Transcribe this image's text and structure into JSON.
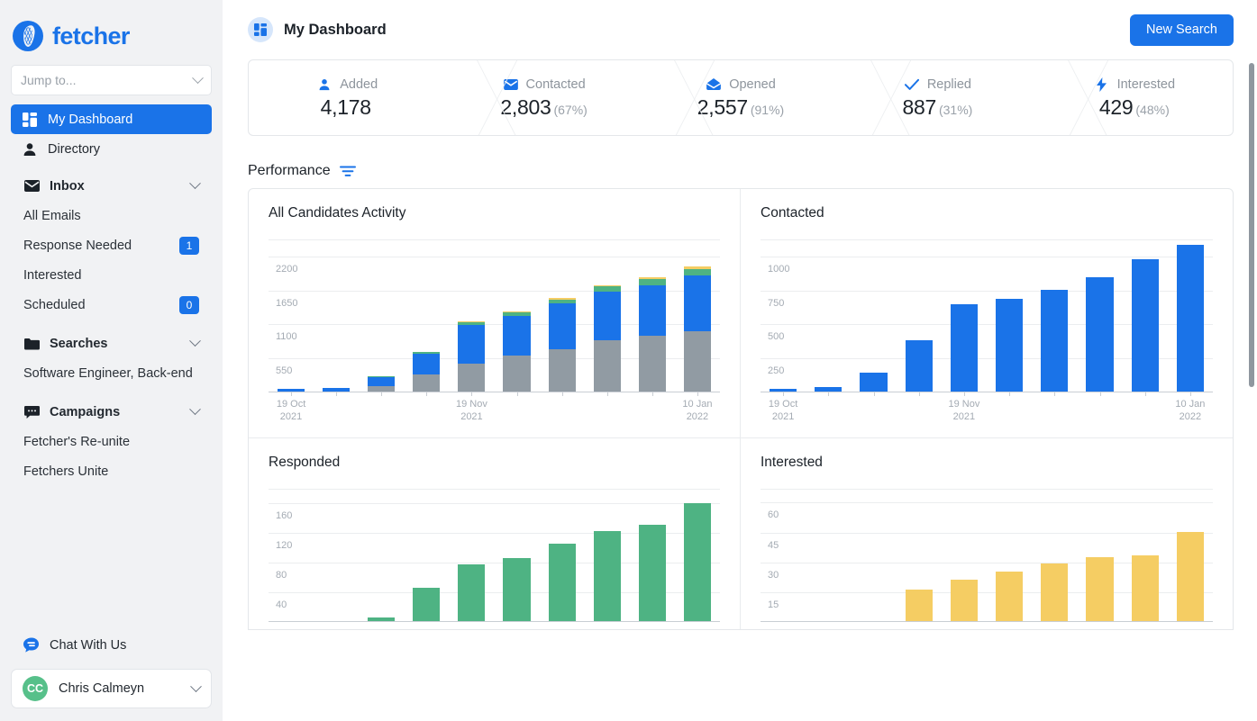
{
  "brand": {
    "name": "fetcher",
    "logo_icon": "fetcher-logo-icon",
    "accent": "#1a73e8"
  },
  "sidebar": {
    "jump_to": {
      "placeholder": "Jump to...",
      "value": "",
      "chevron_icon": "chevron-down-icon"
    },
    "nav": [
      {
        "id": "my-dashboard",
        "label": "My Dashboard",
        "icon": "dashboard-grid-icon",
        "active": true
      },
      {
        "id": "directory",
        "label": "Directory",
        "icon": "person-icon",
        "active": false
      }
    ],
    "groups": [
      {
        "id": "inbox",
        "label": "Inbox",
        "icon": "envelope-icon",
        "chevron_icon": "chevron-down-icon",
        "items": [
          {
            "label": "All Emails",
            "badge": null
          },
          {
            "label": "Response Needed",
            "badge": "1"
          },
          {
            "label": "Interested",
            "badge": null
          },
          {
            "label": "Scheduled",
            "badge": "0"
          }
        ]
      },
      {
        "id": "searches",
        "label": "Searches",
        "icon": "folder-icon",
        "chevron_icon": "chevron-down-icon",
        "items": [
          {
            "label": "Software Engineer, Back-end",
            "badge": null
          }
        ]
      },
      {
        "id": "campaigns",
        "label": "Campaigns",
        "icon": "chat-bubble-icon",
        "chevron_icon": "chevron-down-icon",
        "items": [
          {
            "label": "Fetcher's Re-unite",
            "badge": null
          },
          {
            "label": "Fetchers Unite",
            "badge": null
          }
        ]
      }
    ],
    "chat": {
      "label": "Chat With Us",
      "icon": "chat-support-icon"
    },
    "user": {
      "initials": "CC",
      "name": "Chris Calmeyn",
      "avatar_color": "#57c08a",
      "chevron_icon": "chevron-down-icon"
    }
  },
  "header": {
    "title": "My Dashboard",
    "title_icon": "dashboard-grid-icon",
    "new_search_label": "New Search"
  },
  "stats": [
    {
      "id": "added",
      "label": "Added",
      "icon": "person-icon",
      "value": "4,178",
      "percent": ""
    },
    {
      "id": "contacted",
      "label": "Contacted",
      "icon": "envelope-icon",
      "value": "2,803",
      "percent": "(67%)"
    },
    {
      "id": "opened",
      "label": "Opened",
      "icon": "open-mail-icon",
      "value": "2,557",
      "percent": "(91%)"
    },
    {
      "id": "replied",
      "label": "Replied",
      "icon": "check-icon",
      "value": "887",
      "percent": "(31%)"
    },
    {
      "id": "interested",
      "label": "Interested",
      "icon": "bolt-icon",
      "value": "429",
      "percent": "(48%)"
    }
  ],
  "performance": {
    "title": "Performance",
    "filter_icon": "filter-icon"
  },
  "chart_data": [
    {
      "id": "all-candidates-activity",
      "type": "bar",
      "stacked": true,
      "title": "All Candidates Activity",
      "xlabel": "",
      "ylabel": "",
      "ylim": [
        0,
        2475
      ],
      "yticks": [
        550,
        1100,
        1650,
        2200
      ],
      "ytick_labels": [
        "550",
        "1100",
        "1650",
        "2200"
      ],
      "grid": true,
      "x": [
        "19 Oct\n2021",
        "",
        "",
        "",
        "19 Nov\n2021",
        "",
        "",
        "",
        "",
        "10 Jan\n2022"
      ],
      "tick_labels": [
        {
          "index": 0,
          "text_line1": "19 Oct",
          "text_line2": "2021"
        },
        {
          "index": 4,
          "text_line1": "19 Nov",
          "text_line2": "2021"
        },
        {
          "index": 9,
          "text_line1": "10 Jan",
          "text_line2": "2022"
        }
      ],
      "series": [
        {
          "name": "Added",
          "color": "#919ba3",
          "values": [
            0,
            0,
            90,
            280,
            450,
            580,
            690,
            830,
            900,
            980
          ]
        },
        {
          "name": "Contacted",
          "color": "#1a73e8",
          "values": [
            40,
            55,
            145,
            330,
            630,
            640,
            730,
            790,
            820,
            900
          ]
        },
        {
          "name": "Responded",
          "color": "#4eb383",
          "values": [
            0,
            0,
            10,
            25,
            40,
            55,
            70,
            80,
            95,
            100
          ]
        },
        {
          "name": "Interested",
          "color": "#f5cd63",
          "values": [
            0,
            0,
            5,
            10,
            15,
            18,
            22,
            25,
            30,
            38
          ]
        }
      ]
    },
    {
      "id": "contacted",
      "type": "bar",
      "stacked": false,
      "title": "Contacted",
      "xlabel": "",
      "ylabel": "",
      "ylim": [
        0,
        1125
      ],
      "yticks": [
        250,
        500,
        750,
        1000
      ],
      "ytick_labels": [
        "250",
        "500",
        "750",
        "1000"
      ],
      "grid": true,
      "tick_labels": [
        {
          "index": 0,
          "text_line1": "19 Oct",
          "text_line2": "2021"
        },
        {
          "index": 4,
          "text_line1": "19 Nov",
          "text_line2": "2021"
        },
        {
          "index": 9,
          "text_line1": "10 Jan",
          "text_line2": "2022"
        }
      ],
      "series": [
        {
          "name": "Contacted",
          "color": "#1a73e8",
          "values": [
            20,
            35,
            140,
            380,
            640,
            680,
            745,
            840,
            970,
            1080
          ]
        }
      ]
    },
    {
      "id": "responded",
      "type": "bar",
      "stacked": false,
      "title": "Responded",
      "xlabel": "",
      "ylabel": "",
      "ylim": [
        0,
        180
      ],
      "yticks": [
        40,
        80,
        120,
        160
      ],
      "ytick_labels": [
        "40",
        "80",
        "120",
        "160"
      ],
      "grid": true,
      "series": [
        {
          "name": "Responded",
          "color": "#4eb383",
          "values": [
            0,
            0,
            5,
            45,
            77,
            85,
            105,
            122,
            130,
            159
          ]
        }
      ]
    },
    {
      "id": "interested",
      "type": "bar",
      "stacked": false,
      "title": "Interested",
      "xlabel": "",
      "ylabel": "",
      "ylim": [
        0,
        67
      ],
      "yticks": [
        15,
        30,
        45,
        60
      ],
      "ytick_labels": [
        "15",
        "30",
        "45",
        "60"
      ],
      "grid": true,
      "series": [
        {
          "name": "Interested",
          "color": "#f5cd63",
          "values": [
            0,
            0,
            0,
            16,
            21,
            25,
            29,
            32,
            33,
            45
          ]
        }
      ]
    }
  ]
}
